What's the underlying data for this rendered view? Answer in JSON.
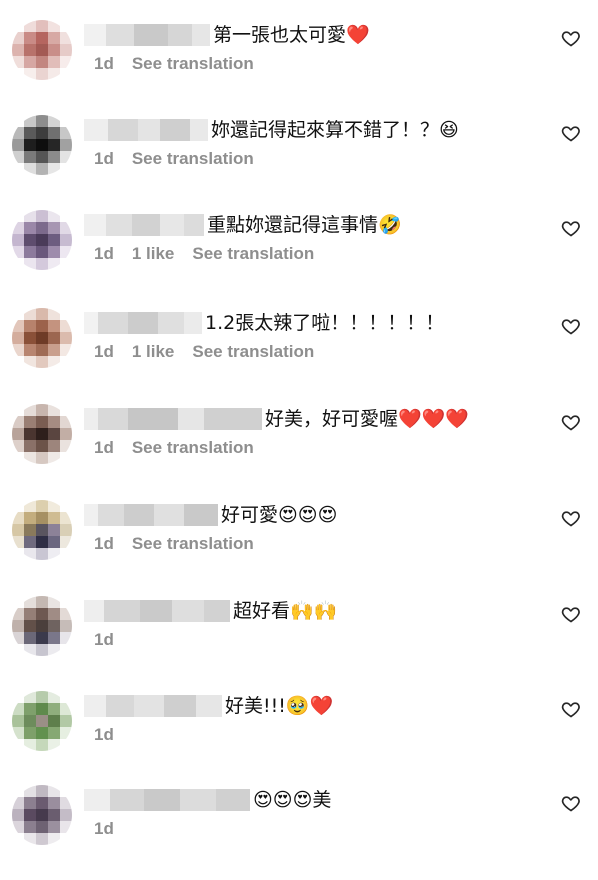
{
  "comments": [
    {
      "text": "第一張也太可愛❤️",
      "age": "1d",
      "likes": "",
      "translate": "See translation"
    },
    {
      "text": "妳還記得起來算不錯了！？😆",
      "age": "1d",
      "likes": "",
      "translate": "See translation"
    },
    {
      "text": "重點妳還記得這事情🤣",
      "age": "1d",
      "likes": "1 like",
      "translate": "See translation"
    },
    {
      "text": "1.2張太辣了啦！！！！！！",
      "age": "1d",
      "likes": "1 like",
      "translate": "See translation"
    },
    {
      "text": "好美，好可愛喔❤️❤️❤️",
      "age": "1d",
      "likes": "",
      "translate": "See translation"
    },
    {
      "text": "好可愛😍😍😍",
      "age": "1d",
      "likes": "",
      "translate": "See translation"
    },
    {
      "text": "超好看🙌🙌",
      "age": "1d",
      "likes": "",
      "translate": ""
    },
    {
      "text": "好美!!!🥹❤️",
      "age": "1d",
      "likes": "",
      "translate": ""
    },
    {
      "text": "😍😍😍美",
      "age": "1d",
      "likes": "",
      "translate": ""
    }
  ],
  "colors": {
    "meta_text": "#8e8e8e",
    "heart_icon": "#262626"
  },
  "icons": {
    "like": "heart-outline-icon"
  }
}
